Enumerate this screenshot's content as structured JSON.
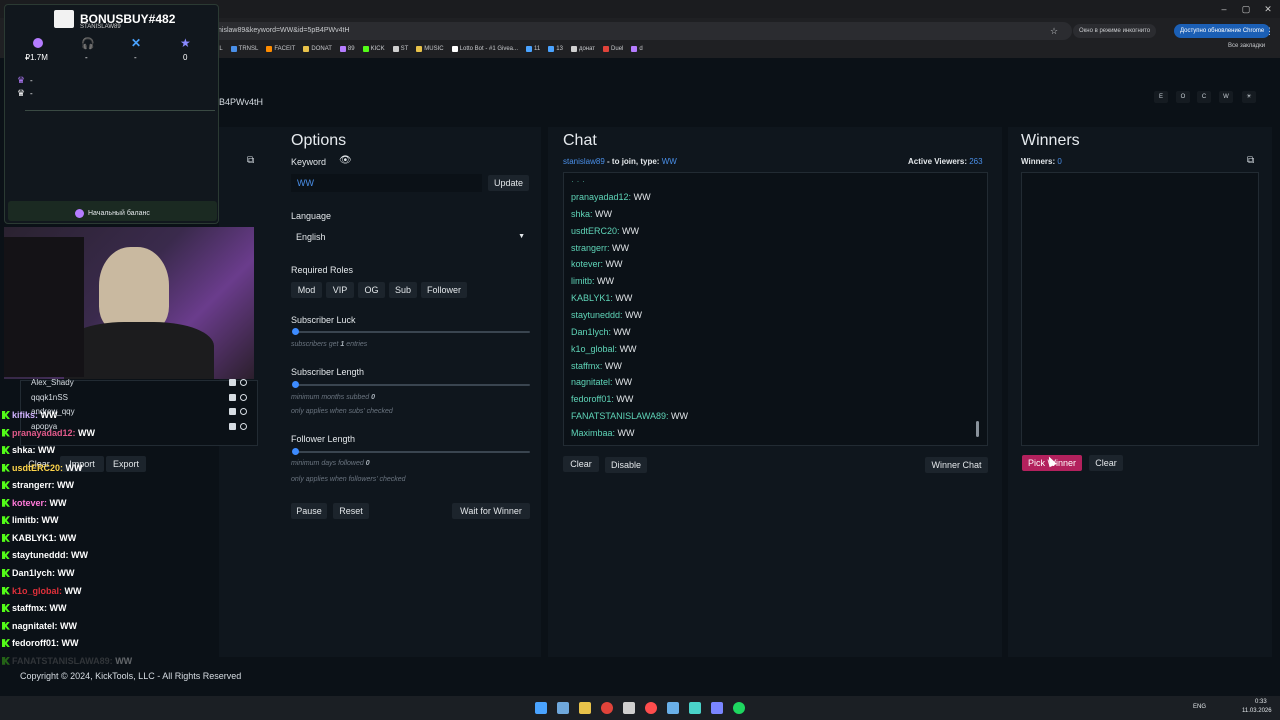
{
  "browser": {
    "url": "nislaw89&keyword=WW&id=5pB4PWv4tH",
    "incognito_label": "Окно в режиме инкогнито",
    "update_label": "Доступно обновление Chrome",
    "bookmarks": [
      "GMAIL",
      "TRNSL",
      "FACEIT",
      "DONAT",
      "89",
      "KICK",
      "ST",
      "MUSIC",
      "Lotto Bot - #1 Givea...",
      "11",
      "13",
      "донат",
      "Duel",
      "d"
    ],
    "all_bookmarks": "Все закладки",
    "window_controls": [
      "–",
      "▢",
      "✕"
    ]
  },
  "page": {
    "slug": "B4PWv4tH",
    "corner_buttons": [
      "E",
      "O",
      "C",
      "W",
      "☀"
    ],
    "options": {
      "title": "Options",
      "keyword_label": "Keyword",
      "keyword_value": "WW",
      "update_label": "Update",
      "language_label": "Language",
      "language_value": "English",
      "roles_label": "Required Roles",
      "roles": [
        "Mod",
        "VIP",
        "OG",
        "Sub",
        "Follower"
      ],
      "sub_luck_label": "Subscriber Luck",
      "sub_luck_hint_pre": "subscribers get",
      "sub_luck_value": "1",
      "sub_luck_hint_post": "entries",
      "sub_length_label": "Subscriber Length",
      "sub_length_hint": "minimum months subbed",
      "sub_length_value": "0",
      "sub_length_note": "only applies when subs' checked",
      "follower_length_label": "Follower Length",
      "follower_length_hint": "minimum days followed",
      "follower_length_value": "0",
      "follower_length_note": "only applies when followers' checked",
      "pause_label": "Pause",
      "reset_label": "Reset",
      "wait_label": "Wait for Winner"
    },
    "chat": {
      "title": "Chat",
      "join_user": "stanislaw89",
      "join_text": " - to join, type: ",
      "join_keyword": "WW",
      "viewers_label": "Active Viewers:",
      "viewers_value": "263",
      "messages": [
        {
          "user": "pranayadad12:",
          "msg": "WW"
        },
        {
          "user": "shka:",
          "msg": "WW"
        },
        {
          "user": "usdtERC20:",
          "msg": "WW"
        },
        {
          "user": "strangerr:",
          "msg": "WW"
        },
        {
          "user": "kotever:",
          "msg": "WW"
        },
        {
          "user": "limitb:",
          "msg": "WW"
        },
        {
          "user": "KABLYK1:",
          "msg": "WW"
        },
        {
          "user": "staytuneddd:",
          "msg": "WW"
        },
        {
          "user": "Dan1lych:",
          "msg": "WW"
        },
        {
          "user": "k1o_global:",
          "msg": "WW"
        },
        {
          "user": "staffmx:",
          "msg": "WW"
        },
        {
          "user": "nagnitatel:",
          "msg": "WW"
        },
        {
          "user": "fedoroff01:",
          "msg": "WW"
        },
        {
          "user": "FANATSTANISLAWA89:",
          "msg": "WW"
        },
        {
          "user": "Maximbaa:",
          "msg": "WW"
        }
      ],
      "clear_label": "Clear",
      "disable_label": "Disable",
      "winner_chat_label": "Winner Chat"
    },
    "winners": {
      "title": "Winners",
      "count_label": "Winners:",
      "count_value": "0",
      "pick_label": "Pick Winner",
      "clear_label": "Clear"
    },
    "left_panel": {
      "entrants": [
        "Alex_Shady",
        "qqqk1nSS",
        "andrew_qqy",
        "apopya"
      ],
      "clear_label": "Clear",
      "import_label": "Import",
      "export_label": "Export"
    },
    "footer": "Copyright © 2024, KickTools, LLC - All Rights Reserved"
  },
  "stream_overlay": {
    "title": "BONUSBUY#482",
    "subtitle": "STANISLAW89",
    "stats": [
      "₽1.7M",
      "-",
      "-",
      "0"
    ],
    "rows": [
      "-",
      "-"
    ],
    "balance_label": "Начальный баланс",
    "chat": [
      {
        "user": "kifiks:",
        "msg": "WW"
      },
      {
        "user": "pranayadad12:",
        "msg": "WW"
      },
      {
        "user": "shka:",
        "msg": "WW"
      },
      {
        "user": "usdtERC20:",
        "msg": "WW"
      },
      {
        "user": "strangerr:",
        "msg": "WW"
      },
      {
        "user": "kotever:",
        "msg": "WW"
      },
      {
        "user": "limitb:",
        "msg": "WW"
      },
      {
        "user": "KABLYK1:",
        "msg": "WW"
      },
      {
        "user": "staytuneddd:",
        "msg": "WW"
      },
      {
        "user": "Dan1lych:",
        "msg": "WW"
      },
      {
        "user": "k1o_global:",
        "msg": "WW"
      },
      {
        "user": "staffmx:",
        "msg": "WW"
      },
      {
        "user": "nagnitatel:",
        "msg": "WW"
      },
      {
        "user": "fedoroff01:",
        "msg": "WW"
      },
      {
        "user": "FANATSTANISLAWA89:",
        "msg": "WW"
      }
    ],
    "chat_colors": [
      "#d1b3ff",
      "#e05a8a",
      "#ffffff",
      "#ffd54a",
      "#ffffff",
      "#ff7ad9",
      "#ffffff",
      "#ffffff",
      "#ffffff",
      "#ffffff",
      "#e0303a",
      "#ffffff",
      "#ffffff",
      "#ffffff",
      "#777777"
    ]
  },
  "taskbar": {
    "lang": "ENG",
    "time": "0:33",
    "date": "11.03.2026"
  },
  "colors": {
    "accent": "#3d8bff",
    "kick": "#53fc18",
    "pick": "#b3215d"
  }
}
